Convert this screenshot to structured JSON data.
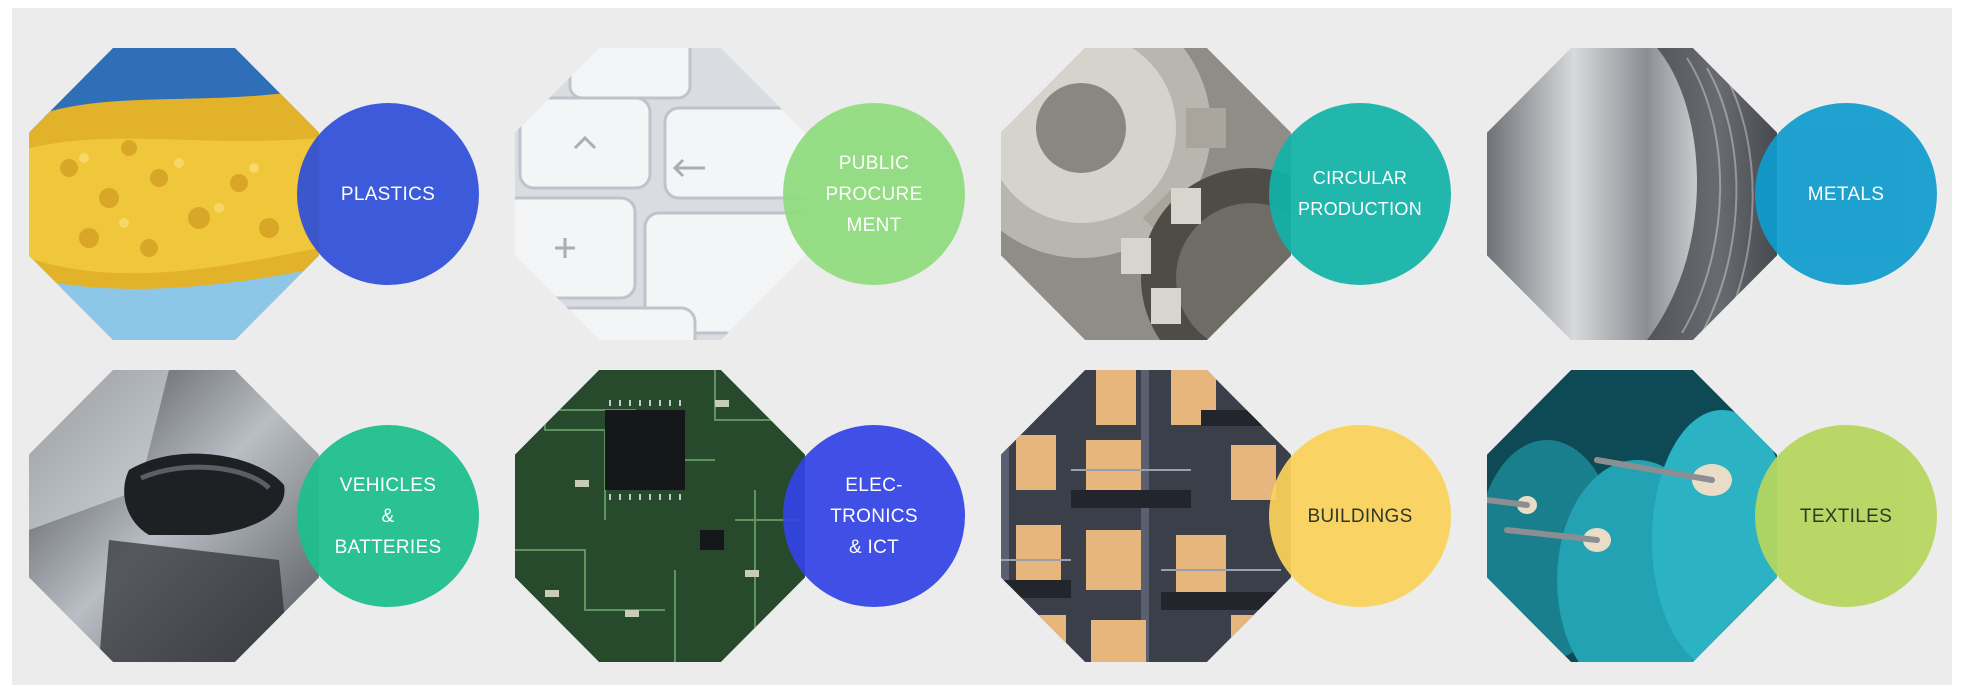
{
  "categories": [
    {
      "id": "plastics",
      "label": "PLASTICS",
      "color": "#2f4fd8",
      "image": "plastic-pellets-image"
    },
    {
      "id": "public-procurement",
      "label": "PUBLIC\nPROCURE\nMENT",
      "color": "#8fdc7e",
      "image": "keyboard-keys-image"
    },
    {
      "id": "circular-production",
      "label": "CIRCULAR\nPRODUCTION",
      "color": "#12b3a8",
      "image": "gears-image"
    },
    {
      "id": "metals",
      "label": "METALS",
      "color": "#0f9ccc",
      "image": "steel-coil-image"
    },
    {
      "id": "vehicles-batteries",
      "label": "VEHICLES\n&\nBATTERIES",
      "color": "#1dbf8d",
      "image": "car-mirror-image"
    },
    {
      "id": "electronics-ict",
      "label": "ELEC-\nTRONICS\n& ICT",
      "color": "#3344e6",
      "image": "circuit-board-image"
    },
    {
      "id": "buildings",
      "label": "BUILDINGS",
      "color": "#fbd35b",
      "image": "apartment-building-image"
    },
    {
      "id": "textiles",
      "label": "TEXTILES",
      "color": "#b6d65e",
      "image": "yarn-spools-image"
    }
  ]
}
